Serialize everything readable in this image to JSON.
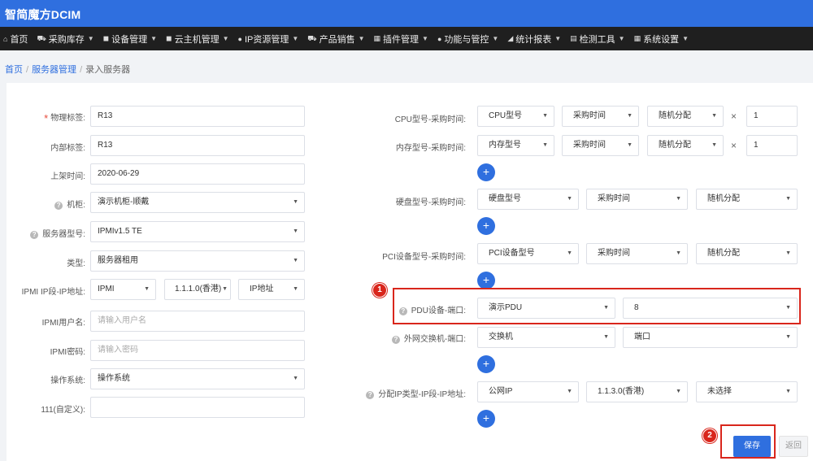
{
  "app": {
    "title": "智简魔方DCIM"
  },
  "nav": {
    "items": [
      {
        "icon": "home-icon",
        "glyph": "⌂",
        "label": "首页",
        "dropdown": false
      },
      {
        "icon": "car-icon",
        "glyph": "⛟",
        "label": "采购库存",
        "dropdown": true
      },
      {
        "icon": "cube-icon",
        "glyph": "◼",
        "label": "设备管理",
        "dropdown": true
      },
      {
        "icon": "cloud-host-icon",
        "glyph": "◼",
        "label": "云主机管理",
        "dropdown": true
      },
      {
        "icon": "location-icon",
        "glyph": "●",
        "label": "IP资源管理",
        "dropdown": true
      },
      {
        "icon": "cart-icon",
        "glyph": "⛟",
        "label": "产品销售",
        "dropdown": true
      },
      {
        "icon": "grid-icon",
        "glyph": "▦",
        "label": "插件管理",
        "dropdown": true
      },
      {
        "icon": "info-icon",
        "glyph": "●",
        "label": "功能与管控",
        "dropdown": true
      },
      {
        "icon": "chart-icon",
        "glyph": "◢",
        "label": "统计报表",
        "dropdown": true
      },
      {
        "icon": "list-icon",
        "glyph": "▤",
        "label": "检测工具",
        "dropdown": true
      },
      {
        "icon": "settings-grid-icon",
        "glyph": "▦",
        "label": "系统设置",
        "dropdown": true
      }
    ]
  },
  "breadcrumb": {
    "home": "首页",
    "parent": "服务器管理",
    "current": "录入服务器",
    "separator": "/"
  },
  "left_form": {
    "physical_tag": {
      "label": "物理标签:",
      "value": "R13"
    },
    "internal_tag": {
      "label": "内部标签:",
      "value": "R13"
    },
    "shelf_time": {
      "label": "上架时间:",
      "value": "2020-06-29"
    },
    "cabinet": {
      "label": "机柜:",
      "value": "演示机柜-顺戴"
    },
    "server_model": {
      "label": "服务器型号:",
      "value": "IPMIv1.5 TE"
    },
    "type": {
      "label": "类型:",
      "value": "服务器租用"
    },
    "ipmi_ip": {
      "label": "IPMI IP段-IP地址:",
      "protocol": "IPMI",
      "segment": "1.1.1.0(香港)",
      "address": "IP地址"
    },
    "ipmi_user": {
      "label": "IPMI用户名:",
      "placeholder": "请输入用户名"
    },
    "ipmi_password": {
      "label": "IPMI密码:",
      "placeholder": "请输入密码"
    },
    "os": {
      "label": "操作系统:",
      "value": "操作系统"
    },
    "custom_111": {
      "label": "111(自定义):",
      "value": ""
    }
  },
  "right_form": {
    "times_symbol": "×",
    "plus_symbol": "+",
    "cpu": {
      "label": "CPU型号-采购时间:",
      "model": "CPU型号",
      "time": "采购时间",
      "alloc": "随机分配",
      "qty": "1"
    },
    "memory": {
      "label": "内存型号-采购时间:",
      "model": "内存型号",
      "time": "采购时间",
      "alloc": "随机分配",
      "qty": "1"
    },
    "disk": {
      "label": "硬盘型号-采购时间:",
      "model": "硬盘型号",
      "time": "采购时间",
      "alloc": "随机分配"
    },
    "pci": {
      "label": "PCI设备型号-采购时间:",
      "model": "PCI设备型号",
      "time": "采购时间",
      "alloc": "随机分配"
    },
    "pdu": {
      "label": "PDU设备-端口:",
      "device": "演示PDU",
      "port": "8"
    },
    "switch": {
      "label": "外网交换机-端口:",
      "device": "交换机",
      "port": "端口"
    },
    "ip_alloc": {
      "label": "分配IP类型-IP段-IP地址:",
      "ip_type": "公网IP",
      "segment": "1.1.3.0(香港)",
      "address": "未选择"
    }
  },
  "annotations": {
    "badge1": "1",
    "badge2": "2",
    "highlight_color": "#d9261c"
  },
  "actions": {
    "save": "保存",
    "back": "返回"
  },
  "colors": {
    "brand": "#2f6fdf",
    "navbar": "#1f1f1f",
    "primary_button": "#2f6fdf"
  }
}
